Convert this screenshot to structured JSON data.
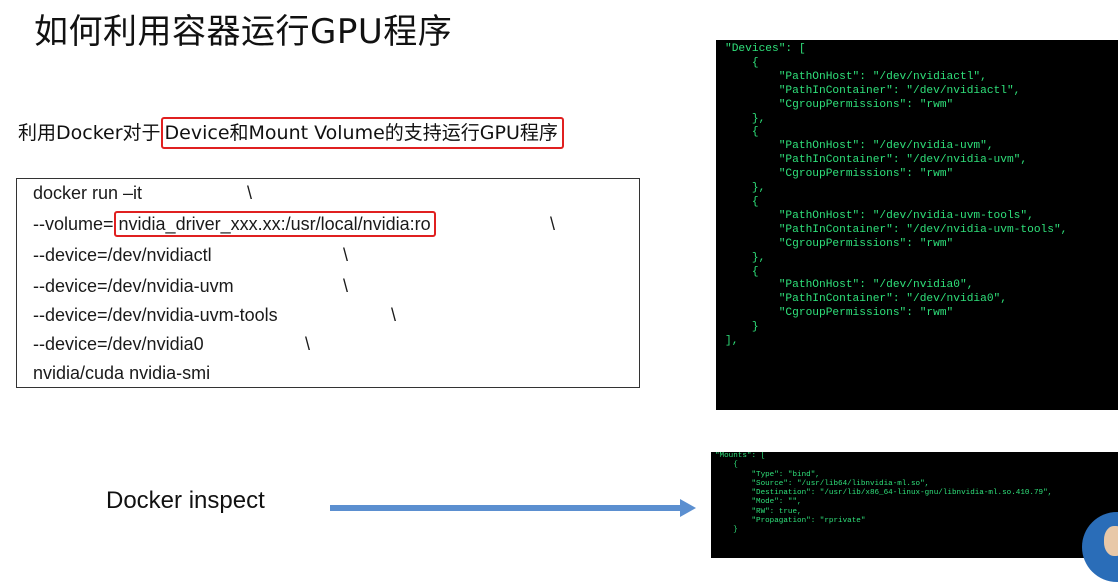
{
  "title": "如何利用容器运行GPU程序",
  "subtitle": {
    "prefix": "利用Docker对于",
    "highlight": "Device和Mount Volume的支持运行GPU程序"
  },
  "command": {
    "line1": "docker run –it",
    "line2_prefix": "--volume=",
    "line2_highlight": "nvidia_driver_xxx.xx:/usr/local/nvidia:ro",
    "line3": "--device=/dev/nvidiactl",
    "line4": "--device=/dev/nvidia-uvm",
    "line5": "--device=/dev/nvidia-uvm-tools",
    "line6": "--device=/dev/nvidia0",
    "line7": "nvidia/cuda nvidia-smi",
    "continuation": "\\"
  },
  "devices_json": "\"Devices\": [\n    {\n        \"PathOnHost\": \"/dev/nvidiactl\",\n        \"PathInContainer\": \"/dev/nvidiactl\",\n        \"CgroupPermissions\": \"rwm\"\n    },\n    {\n        \"PathOnHost\": \"/dev/nvidia-uvm\",\n        \"PathInContainer\": \"/dev/nvidia-uvm\",\n        \"CgroupPermissions\": \"rwm\"\n    },\n    {\n        \"PathOnHost\": \"/dev/nvidia-uvm-tools\",\n        \"PathInContainer\": \"/dev/nvidia-uvm-tools\",\n        \"CgroupPermissions\": \"rwm\"\n    },\n    {\n        \"PathOnHost\": \"/dev/nvidia0\",\n        \"PathInContainer\": \"/dev/nvidia0\",\n        \"CgroupPermissions\": \"rwm\"\n    }\n],",
  "mounts_json": "\"Mounts\": [\n    {\n        \"Type\": \"bind\",\n        \"Source\": \"/usr/lib64/libnvidia-ml.so\",\n        \"Destination\": \"/usr/lib/x86_64-linux-gnu/libnvidia-ml.so.410.79\",\n        \"Mode\": \"\",\n        \"RW\": true,\n        \"Propagation\": \"rprivate\"\n    }",
  "inspect_label": "Docker inspect",
  "colors": {
    "highlight_border": "#e02020",
    "terminal_bg": "#000000",
    "terminal_text": "#2fe07a",
    "arrow": "#5b8fd0"
  }
}
